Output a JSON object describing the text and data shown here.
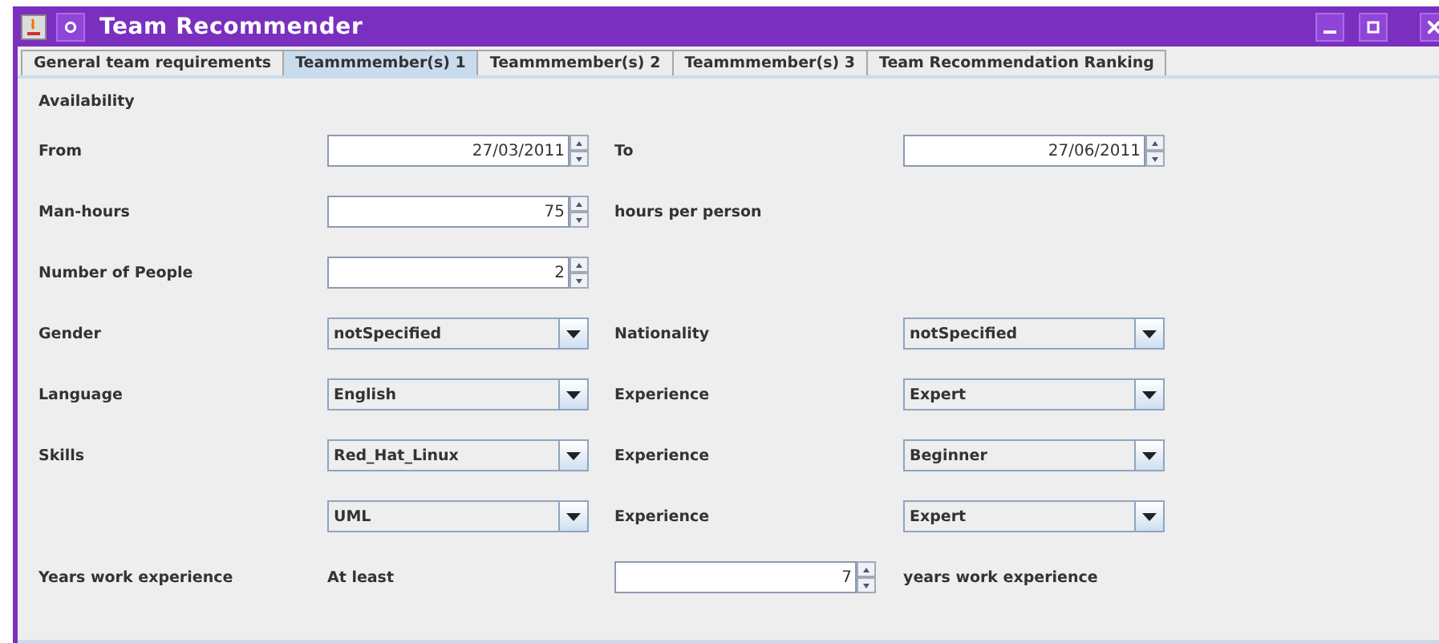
{
  "window": {
    "title": "Team Recommender"
  },
  "tabs": [
    {
      "label": "General team requirements",
      "selected": false
    },
    {
      "label": "Teammmember(s) 1",
      "selected": true
    },
    {
      "label": "Teammmember(s) 2",
      "selected": false
    },
    {
      "label": "Teammmember(s) 3",
      "selected": false
    },
    {
      "label": "Team Recommendation Ranking",
      "selected": false
    }
  ],
  "section_title": "Availability",
  "rows": [
    {
      "cells": [
        {
          "kind": "label",
          "text": "From"
        },
        {
          "kind": "spinner",
          "value": "27/03/2011"
        },
        {
          "kind": "label",
          "text": "To"
        },
        {
          "kind": "spinner",
          "value": "27/06/2011"
        }
      ]
    },
    {
      "cells": [
        {
          "kind": "label",
          "text": "Man-hours"
        },
        {
          "kind": "spinner",
          "value": "75"
        },
        {
          "kind": "label",
          "text": "hours per person"
        },
        {
          "kind": "empty"
        }
      ]
    },
    {
      "cells": [
        {
          "kind": "label",
          "text": "Number of People"
        },
        {
          "kind": "spinner",
          "value": "2"
        },
        {
          "kind": "empty"
        },
        {
          "kind": "empty"
        }
      ]
    },
    {
      "cells": [
        {
          "kind": "label",
          "text": "Gender"
        },
        {
          "kind": "combo",
          "value": "notSpecified"
        },
        {
          "kind": "label",
          "text": "Nationality"
        },
        {
          "kind": "combo",
          "value": "notSpecified"
        }
      ]
    },
    {
      "cells": [
        {
          "kind": "label",
          "text": "Language"
        },
        {
          "kind": "combo",
          "value": "English"
        },
        {
          "kind": "label",
          "text": "Experience"
        },
        {
          "kind": "combo",
          "value": "Expert"
        }
      ]
    },
    {
      "cells": [
        {
          "kind": "label",
          "text": "Skills"
        },
        {
          "kind": "combo",
          "value": "Red_Hat_Linux"
        },
        {
          "kind": "label",
          "text": "Experience"
        },
        {
          "kind": "combo",
          "value": "Beginner"
        }
      ]
    },
    {
      "cells": [
        {
          "kind": "empty"
        },
        {
          "kind": "combo",
          "value": "UML"
        },
        {
          "kind": "label",
          "text": "Experience"
        },
        {
          "kind": "combo",
          "value": "Expert"
        }
      ]
    },
    {
      "cells": [
        {
          "kind": "label",
          "text": "Years work experience"
        },
        {
          "kind": "label",
          "text": "At least"
        },
        {
          "kind": "spinner",
          "value": "7"
        },
        {
          "kind": "label",
          "text": "years work experience"
        }
      ]
    }
  ]
}
